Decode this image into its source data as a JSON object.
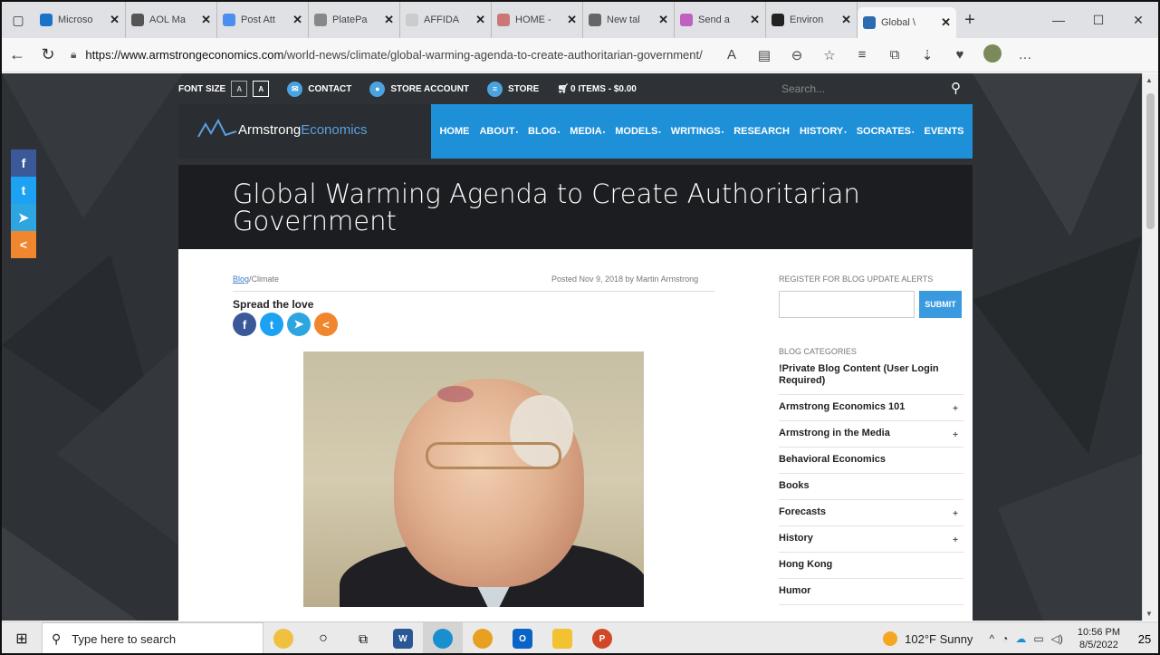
{
  "browser": {
    "tabs": [
      {
        "label": "Microso",
        "color": "#1a73c8"
      },
      {
        "label": "AOL Ma",
        "color": "#555555"
      },
      {
        "label": "Post Att",
        "color": "#4a8ef0"
      },
      {
        "label": "PlatePa",
        "color": "#888888"
      },
      {
        "label": "AFFIDA",
        "color": "#cccccc"
      },
      {
        "label": "HOME -",
        "color": "#c77"
      },
      {
        "label": "New tal",
        "color": "#666666"
      },
      {
        "label": "Send a",
        "color": "#c060c0"
      },
      {
        "label": "Environ",
        "color": "#222222"
      },
      {
        "label": "Global \\",
        "color": "#2b6cb0",
        "active": true
      }
    ],
    "new_tab": "+",
    "url_host": "https://www.armstrongeconomics.com",
    "url_path": "/world-news/climate/global-warming-agenda-to-create-authoritarian-government/"
  },
  "site": {
    "utility": {
      "font_size_label": "FONT SIZE",
      "font_small": "A",
      "font_large": "A",
      "contact": "CONTACT",
      "store_account": "STORE ACCOUNT",
      "store": "STORE",
      "cart": "0 ITEMS - $0.00",
      "search_placeholder": "Search..."
    },
    "logo": {
      "part1": "Armstrong",
      "part2": "Economics"
    },
    "nav": [
      {
        "label": "HOME",
        "sub": false
      },
      {
        "label": "ABOUT",
        "sub": true
      },
      {
        "label": "BLOG",
        "sub": true
      },
      {
        "label": "MEDIA",
        "sub": true
      },
      {
        "label": "MODELS",
        "sub": true
      },
      {
        "label": "WRITINGS",
        "sub": true
      },
      {
        "label": "RESEARCH",
        "sub": false
      },
      {
        "label": "HISTORY",
        "sub": true
      },
      {
        "label": "SOCRATES",
        "sub": true
      },
      {
        "label": "EVENTS",
        "sub": false
      }
    ],
    "article": {
      "title": "Global Warming Agenda to Create Authoritarian Government",
      "crumb_blog": "Blog",
      "crumb_rest": "/Climate",
      "posted": "Posted Nov 9, 2018 by Martin Armstrong",
      "spread": "Spread the love"
    },
    "sidebar": {
      "register_label": "REGISTER FOR BLOG UPDATE ALERTS",
      "submit": "SUBMIT",
      "categories_label": "BLOG CATEGORIES",
      "categories": [
        {
          "label": "!Private Blog Content (User Login Required)",
          "plus": false
        },
        {
          "label": "Armstrong Economics 101",
          "plus": true
        },
        {
          "label": "Armstrong in the Media",
          "plus": true
        },
        {
          "label": "Behavioral Economics",
          "plus": false
        },
        {
          "label": "Books",
          "plus": false
        },
        {
          "label": "Forecasts",
          "plus": true
        },
        {
          "label": "History",
          "plus": true
        },
        {
          "label": "Hong Kong",
          "plus": false
        },
        {
          "label": "Humor",
          "plus": false
        }
      ]
    }
  },
  "taskbar": {
    "search_placeholder": "Type here to search",
    "weather": "102°F  Sunny",
    "time": "10:56 PM",
    "date": "8/5/2022",
    "notifications": "25"
  }
}
